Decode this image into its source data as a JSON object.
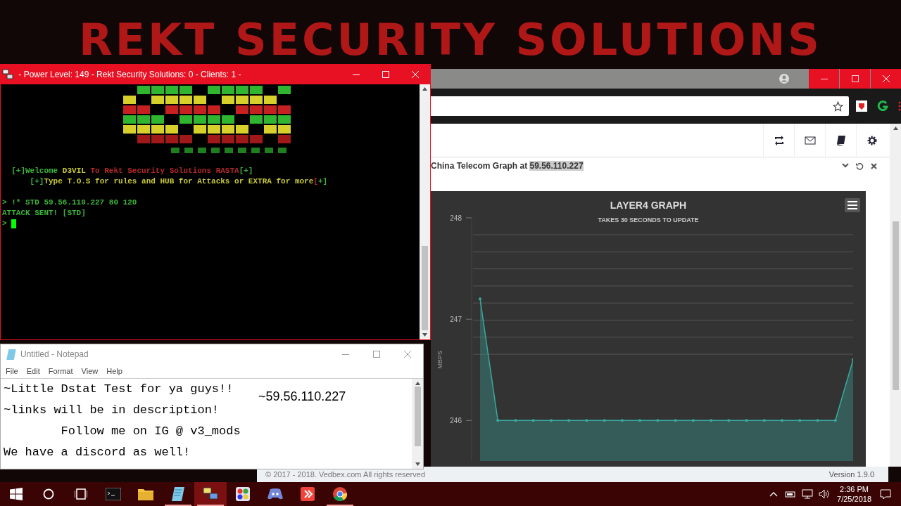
{
  "wallpaper": {
    "title": "REKT SECURITY SOLUTIONS"
  },
  "terminal": {
    "title": " - Power Level: 149 - Rekt Security Solutions: 0 - Clients: 1 -",
    "lines": [
      {
        "segments": [
          {
            "text": "  [+]Welcome ",
            "color": "#3cb43c"
          },
          {
            "text": "D3VIL ",
            "color": "#c8c83c"
          },
          {
            "text": "To Rekt Security Solutions RASTA",
            "color": "#b42828"
          },
          {
            "text": "[+]",
            "color": "#3cb43c"
          }
        ]
      },
      {
        "segments": [
          {
            "text": "      [+]",
            "color": "#3cb43c"
          },
          {
            "text": "Type T.O.S for rules and HUB for Attacks or EXTRA for more",
            "color": "#c8c83c"
          },
          {
            "text": "[",
            "color": "#b42828"
          },
          {
            "text": "+]",
            "color": "#3cb43c"
          }
        ]
      },
      {
        "segments": [
          {
            "text": "> !* STD 59.56.110.227 80 120",
            "color": "#3cb43c"
          }
        ]
      },
      {
        "segments": [
          {
            "text": "ATTACK SENT! [STD]",
            "color": "#3cb43c"
          }
        ]
      },
      {
        "cursor": true,
        "segments": [
          {
            "text": "> ",
            "color": "#3cb43c"
          }
        ]
      }
    ]
  },
  "notepad": {
    "title": "Untitled - Notepad",
    "menu": [
      "File",
      "Edit",
      "Format",
      "View",
      "Help"
    ],
    "lines": [
      "~Little Dstat Test for ya guys!!",
      "~links will be in description!",
      "        Follow me on IG @ v3_mods",
      "We have a discord as well!"
    ],
    "overlay_text": "~59.56.110.227"
  },
  "browser": {
    "panel_title": "China Telecom Graph at ",
    "panel_highlight": "59.56.110.227",
    "footer_copyright": "© 2017 - 2018. Vedbex.com All rights reserved",
    "footer_version": "Version 1.9.0",
    "chart_data": {
      "type": "area",
      "title": "LAYER4 GRAPH",
      "subtitle": "TAKES 30 SECONDS TO UPDATE",
      "ylabel": "MBPS",
      "ylim": [
        245.6,
        248
      ],
      "yticks": [
        246,
        247,
        248
      ],
      "series": [
        {
          "color": "#3aa99f",
          "values": [
            247.2,
            246,
            246,
            246,
            246,
            246,
            246,
            246,
            246,
            246,
            246,
            246,
            246,
            246,
            246,
            246,
            246,
            246,
            246,
            246,
            246,
            246.6
          ]
        }
      ]
    }
  },
  "taskbar": {
    "apps": [
      {
        "kind": "start",
        "running": false,
        "selected": false
      },
      {
        "kind": "search",
        "running": false,
        "selected": false
      },
      {
        "kind": "taskview",
        "running": false,
        "selected": false
      },
      {
        "kind": "terminal",
        "running": false,
        "selected": false
      },
      {
        "kind": "folder",
        "running": false,
        "selected": false
      },
      {
        "kind": "notepad",
        "running": true,
        "selected": false
      },
      {
        "kind": "network",
        "running": true,
        "selected": true
      },
      {
        "kind": "grid",
        "running": false,
        "selected": false
      },
      {
        "kind": "chat",
        "running": false,
        "selected": false
      },
      {
        "kind": "remote",
        "running": false,
        "selected": false
      },
      {
        "kind": "browser",
        "running": true,
        "selected": false
      }
    ],
    "time": "2:36 PM",
    "date": "7/25/2018"
  }
}
